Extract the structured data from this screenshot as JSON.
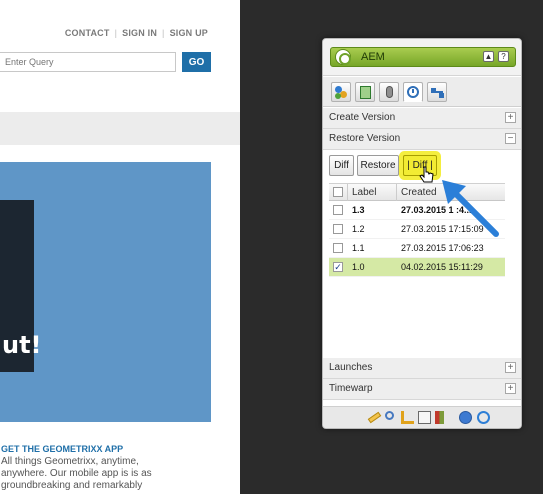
{
  "site": {
    "nav": {
      "contact": "CONTACT",
      "sign_in": "SIGN IN",
      "sign_up": "SIGN UP"
    },
    "search": {
      "placeholder": "Enter Query",
      "go_label": "GO"
    },
    "hero_text": "ut!",
    "app_promo": {
      "title": "GET THE GEOMETRIXX APP",
      "lines": [
        "All things Geometrixx, anytime,",
        "anywhere. Our mobile app is is as",
        "groundbreaking and remarkably"
      ]
    }
  },
  "sidekick": {
    "title": "AEM",
    "title_buttons": [
      "▲",
      "?"
    ],
    "tabs": [
      "page-tab-icon",
      "components-tab-icon",
      "workflow-tab-icon",
      "versioning-tab-icon",
      "information-tab-icon"
    ],
    "sections": {
      "create_version": "Create Version",
      "restore_version": "Restore Version",
      "launches": "Launches",
      "timewarp": "Timewarp"
    },
    "toolbar": {
      "diff": "Diff",
      "restore": "Restore",
      "diff_previous": "| Diff |"
    },
    "table": {
      "headers": [
        "Label",
        "Created"
      ],
      "rows": [
        {
          "label": "1.3",
          "created": "27.03.2015 1 :4...",
          "checked": false,
          "bold": true,
          "selected": false
        },
        {
          "label": "1.2",
          "created": "27.03.2015 17:15:09",
          "checked": false,
          "bold": false,
          "selected": false
        },
        {
          "label": "1.1",
          "created": "27.03.2015 17:06:23",
          "checked": false,
          "bold": false,
          "selected": false
        },
        {
          "label": "1.0",
          "created": "04.02.2015 15:11:29",
          "checked": true,
          "bold": false,
          "selected": true
        }
      ]
    },
    "footer_icons": [
      "edit-icon",
      "preview-icon",
      "design-icon",
      "scaffolding-icon",
      "sites-icon",
      "globe-icon",
      "refresh-icon"
    ],
    "colors": {
      "accent": "#77a628",
      "highlight": "#f2ec33",
      "arrow": "#2b7fd8"
    }
  }
}
